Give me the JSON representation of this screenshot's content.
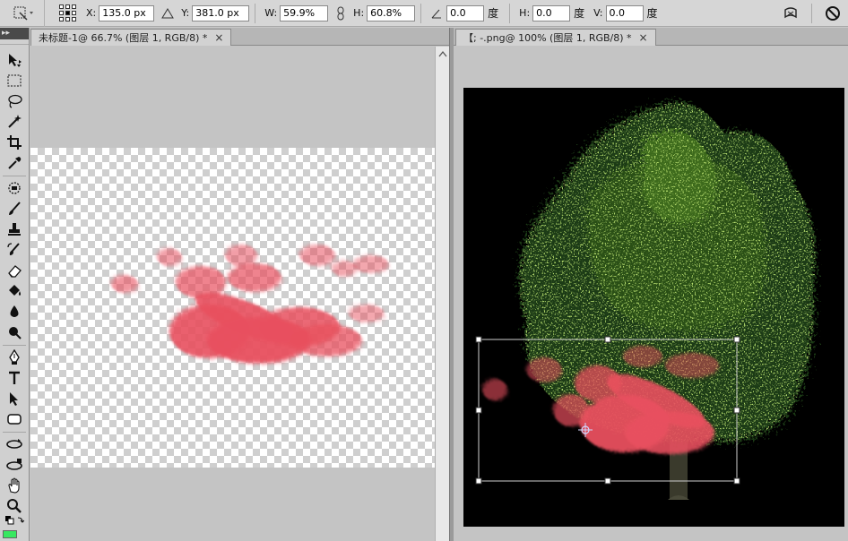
{
  "options_bar": {
    "x_label": "X:",
    "x_value": "135.0 px",
    "y_label": "Y:",
    "y_value": "381.0 px",
    "w_label": "W:",
    "w_value": "59.9%",
    "h_label": "H:",
    "h_value": "60.8%",
    "rotate_value": "0.0",
    "rotate_unit": "度",
    "skew_h_label": "H:",
    "skew_h_value": "0.0",
    "skew_h_unit": "度",
    "skew_v_label": "V:",
    "skew_v_value": "0.0",
    "skew_v_unit": "度"
  },
  "toolbox": {
    "header": "▸▸",
    "foreground_color": "#38e860"
  },
  "documents": [
    {
      "tab_label": "未标题-1@ 66.7% (图层 1, RGB/8) *",
      "close": "×"
    },
    {
      "tab_label": "【; -.png@ 100% (图层 1, RGB/8) *",
      "close": "×"
    }
  ],
  "colors": {
    "brush_pink": "#e8505e",
    "foliage_dark": "#1f3a12",
    "foliage_light": "#6a9a2a",
    "background": "#000000"
  },
  "icons": {
    "move": "move-icon",
    "marquee": "marquee-icon",
    "lasso": "lasso-icon",
    "magic_wand": "magic-wand-icon",
    "crop": "crop-icon",
    "eyedropper": "eyedropper-icon",
    "healing": "healing-brush-icon",
    "brush": "brush-icon",
    "stamp": "clone-stamp-icon",
    "history_brush": "history-brush-icon",
    "eraser": "eraser-icon",
    "paint_bucket": "paint-bucket-icon",
    "blur": "blur-icon",
    "dodge": "dodge-icon",
    "pen": "pen-icon",
    "type": "type-icon",
    "path_select": "path-select-icon",
    "shape": "shape-icon",
    "rotate_3d": "rotate-3d-icon",
    "orbit_3d": "orbit-3d-icon",
    "hand": "hand-icon",
    "zoom": "zoom-icon"
  }
}
